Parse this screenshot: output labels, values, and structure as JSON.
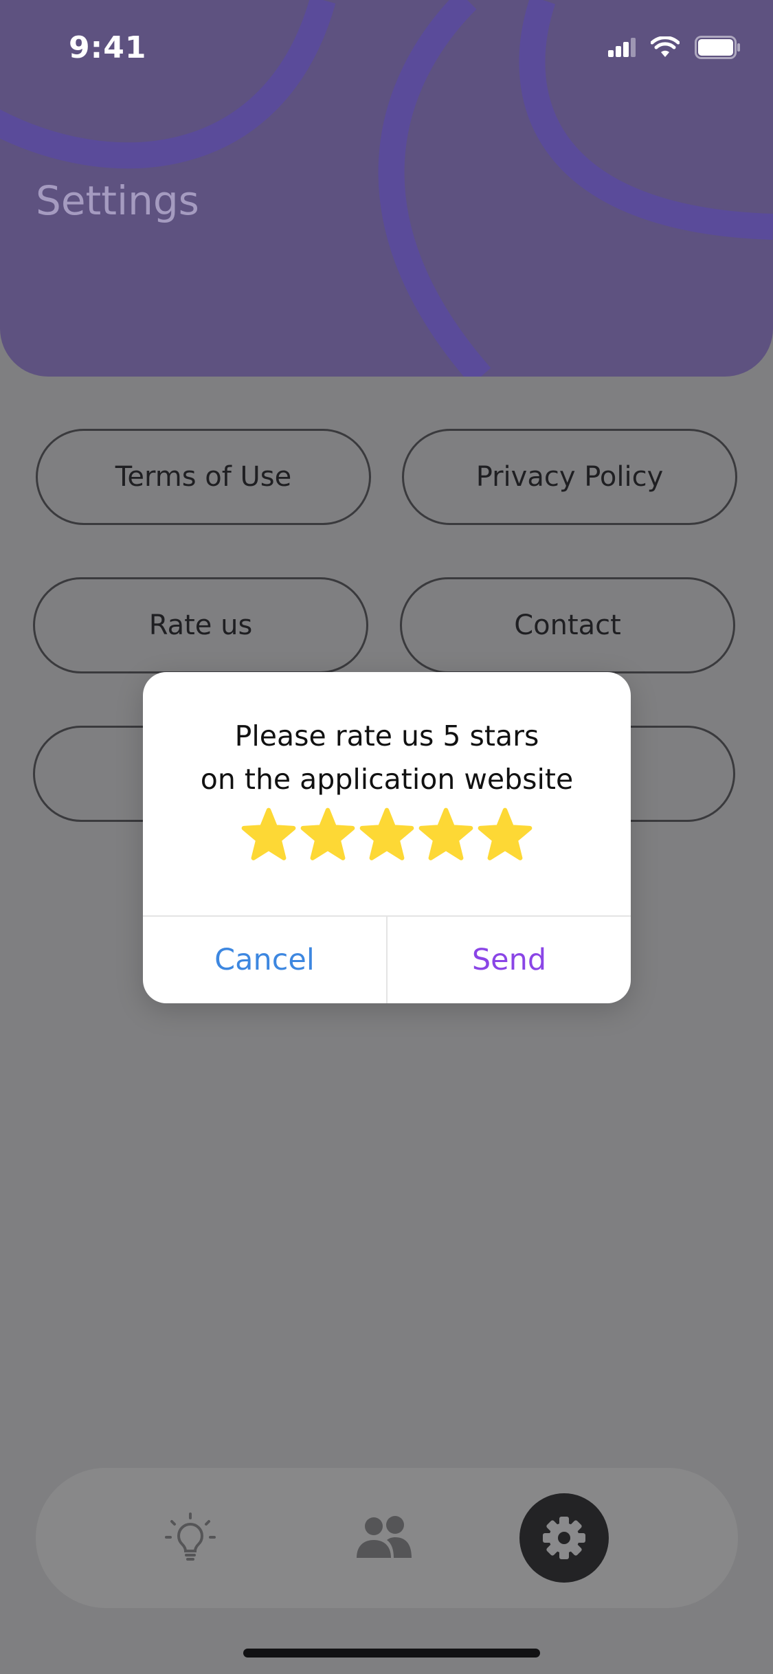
{
  "status_bar": {
    "time": "9:41"
  },
  "header": {
    "title": "Settings"
  },
  "menu": {
    "terms": "Terms of Use",
    "privacy": "Privacy Policy",
    "rate": "Rate us",
    "contact": "Contact"
  },
  "dialog": {
    "line1": "Please rate us 5 stars",
    "line2": "on the application website",
    "rating": 5,
    "rating_max": 5,
    "cancel": "Cancel",
    "send": "Send"
  },
  "tabbar": {
    "items": [
      {
        "icon": "lightbulb-icon"
      },
      {
        "icon": "people-icon"
      },
      {
        "icon": "gear-icon",
        "active": true
      }
    ]
  },
  "colors": {
    "header": "#5e5280",
    "star": "#fdd835",
    "cancel": "#3d87e0",
    "send": "#8a45e6"
  }
}
